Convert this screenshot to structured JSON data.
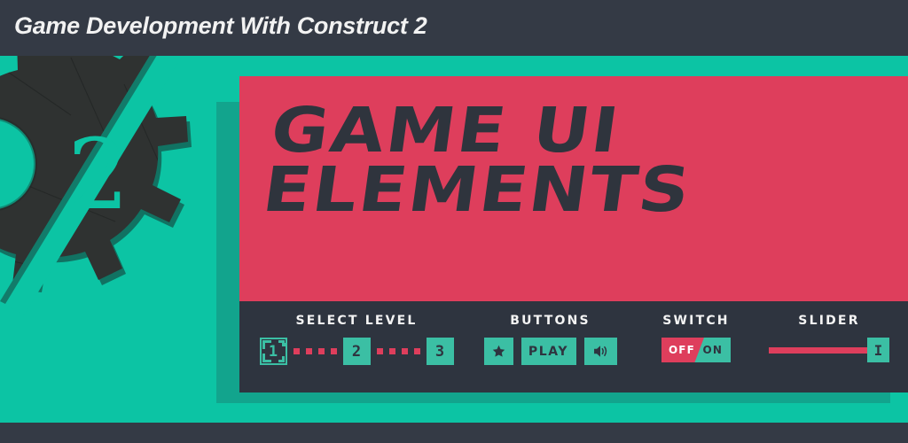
{
  "header": {
    "title": "Game Development With Construct 2",
    "background": "#343a45",
    "text_color": "#f2f2f2"
  },
  "colors": {
    "teal_bg": "#0cc4a4",
    "red_banner": "#de3e5c",
    "dark_panel": "#2e343f",
    "button_teal": "#3bbfa4",
    "dark_bar": "#343a45"
  },
  "logo": {
    "name": "construct-2-logo",
    "digit": "2"
  },
  "banner": {
    "line1": "GAME UI",
    "line2": "ELEMENTS",
    "text": "GAME UI\nELEMENTS"
  },
  "panel": {
    "select_level": {
      "label": "SELECT LEVEL",
      "levels": [
        {
          "value": "1",
          "state": "current"
        },
        {
          "value": "2",
          "state": "available"
        },
        {
          "value": "3",
          "state": "available"
        }
      ],
      "dot_color": "#de3e5c",
      "dots_per_gap": 4
    },
    "buttons": {
      "label": "BUTTONS",
      "items": [
        {
          "name": "favorite-button",
          "icon": "star-icon",
          "label": ""
        },
        {
          "name": "play-button",
          "icon": "",
          "label": "PLAY"
        },
        {
          "name": "sound-button",
          "icon": "speaker-icon",
          "label": ""
        }
      ]
    },
    "switch": {
      "label": "SWITCH",
      "off_label": "OFF",
      "on_label": "ON",
      "state": "ON"
    },
    "slider": {
      "label": "SLIDER",
      "handle_label": "I",
      "value": 100
    }
  }
}
